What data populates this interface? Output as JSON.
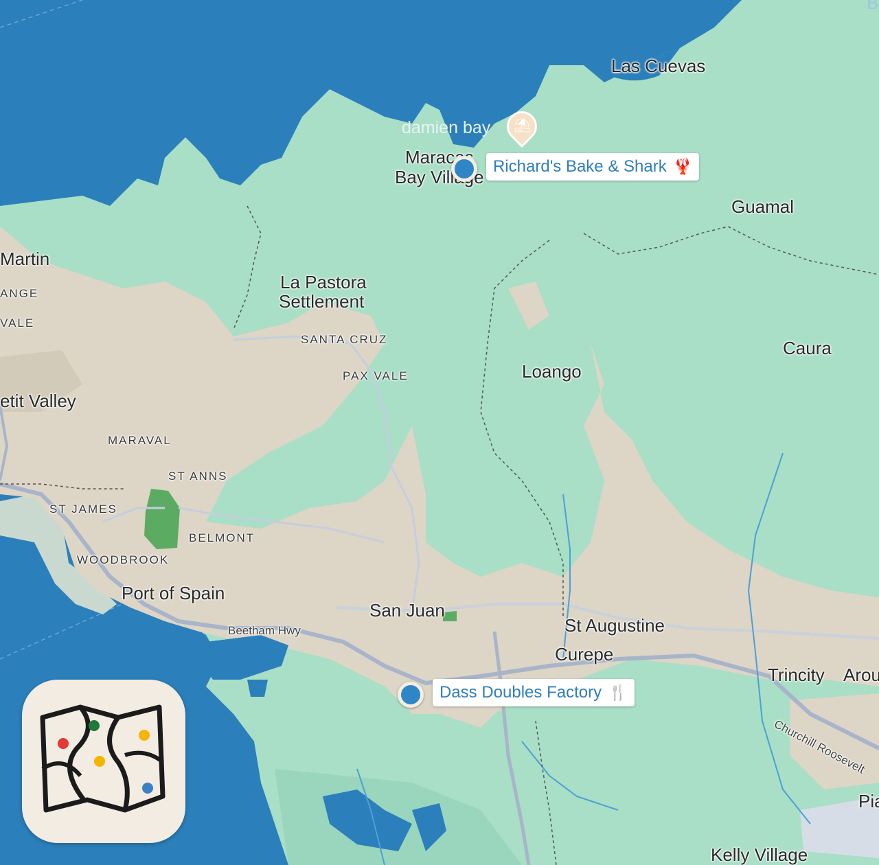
{
  "map": {
    "places": {
      "las_cuevas": "Las Cuevas",
      "damien_bay": "damien bay",
      "maracas_line1": "Maracas",
      "maracas_line2": "Bay Village",
      "guamal": "Guamal",
      "martin": "Martin",
      "ange": "ANGE",
      "vale": "VALE",
      "la_pastora_line1": "La Pastora",
      "la_pastora_line2": "Settlement",
      "santa_cruz": "SANTA CRUZ",
      "pax_vale": "PAX VALE",
      "loango": "Loango",
      "caura": "Caura",
      "petit_valley": "etit Valley",
      "maraval": "MARAVAL",
      "st_anns": "ST ANNS",
      "st_james": "ST JAMES",
      "belmont": "BELMONT",
      "woodbrook": "WOODBROOK",
      "port_of_spain": "Port of Spain",
      "san_juan": "San Juan",
      "st_augustine": "St Augustine",
      "curepe": "Curepe",
      "trincity": "Trincity",
      "arou": "Arou",
      "pia": "Pia",
      "kelly_village": "Kelly Village",
      "b_edge": "B"
    },
    "roads": {
      "beetham": "Beetham Hwy",
      "churchill": "Churchill Roosevelt"
    },
    "pins": [
      {
        "label": "Richard's Bake & Shark",
        "emoji": "🦞",
        "icon": "lobster-icon"
      },
      {
        "label": "Dass Doubles Factory",
        "emoji": "🍴",
        "icon": "fork-knife-icon"
      }
    ],
    "poi_icon": "beach-umbrella-icon",
    "colors": {
      "water": "#2b7fba",
      "forest": "#a8dfc6",
      "urban": "#ddd5c5",
      "park": "#5cab62",
      "pin": "#2f86c6",
      "label_blue": "#2f7fbd"
    }
  },
  "app_icon": {
    "name": "map-app-icon",
    "dots": [
      "#e53935",
      "#1e7a3a",
      "#f4b400",
      "#f4b400",
      "#3b7fc4"
    ]
  }
}
